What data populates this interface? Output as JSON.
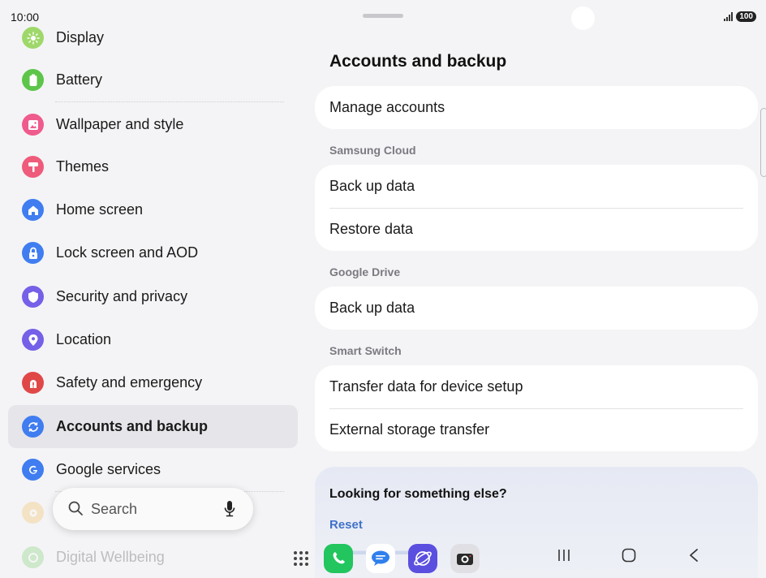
{
  "status": {
    "time": "10:00",
    "battery": "100"
  },
  "sidebar": {
    "items": [
      {
        "label": "Display",
        "color": "#9fd86a"
      },
      {
        "label": "Battery",
        "color": "#5cc54a"
      },
      {
        "label": "Wallpaper and style",
        "color": "#ef5b8c"
      },
      {
        "label": "Themes",
        "color": "#ef5b7b"
      },
      {
        "label": "Home screen",
        "color": "#3f7df0"
      },
      {
        "label": "Lock screen and AOD",
        "color": "#3f7df0"
      },
      {
        "label": "Security and privacy",
        "color": "#7560e8"
      },
      {
        "label": "Location",
        "color": "#7560e8"
      },
      {
        "label": "Safety and emergency",
        "color": "#e04848"
      },
      {
        "label": "Accounts and backup",
        "color": "#3f7df0"
      },
      {
        "label": "Google services",
        "color": "#3f7df0"
      },
      {
        "label": "",
        "color": "#f6b132"
      },
      {
        "label": "Digital Wellbeing",
        "color": "#5cc54a"
      }
    ],
    "selected_index": 9
  },
  "search": {
    "placeholder": "Search"
  },
  "main": {
    "title": "Accounts and backup",
    "manage_accounts": "Manage accounts",
    "sections": [
      {
        "header": "Samsung Cloud",
        "items": [
          "Back up data",
          "Restore data"
        ]
      },
      {
        "header": "Google Drive",
        "items": [
          "Back up data"
        ]
      },
      {
        "header": "Smart Switch",
        "items": [
          "Transfer data for device setup",
          "External storage transfer"
        ]
      }
    ],
    "looking": {
      "title": "Looking for something else?",
      "reset": "Reset"
    }
  },
  "taskbar": {
    "apps": [
      {
        "name": "phone-app",
        "color": "#22c55e"
      },
      {
        "name": "messages-app",
        "color": "#2f80ed"
      },
      {
        "name": "internet-app",
        "color": "#5b4fe0"
      },
      {
        "name": "camera-app",
        "color": "#e0e0e4"
      }
    ]
  }
}
